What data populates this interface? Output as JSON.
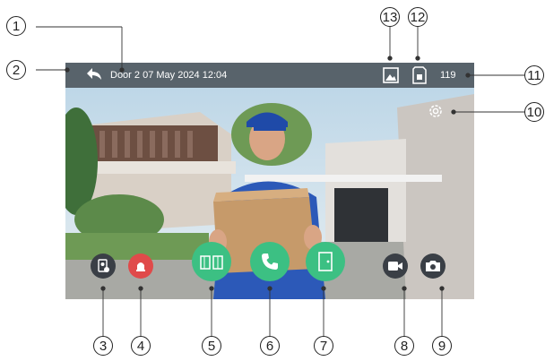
{
  "status_bar": {
    "title": "Door 2  07 May 2024 12:04",
    "count": "119"
  },
  "icons": {
    "back": "back-arrow-icon",
    "picture": "picture-icon",
    "sd_card": "sd-card-icon",
    "settings": "gear-icon",
    "monitor": "monitor-icon",
    "alarm": "alarm-bell-icon",
    "gate": "gate-icon",
    "call": "phone-icon",
    "door": "door-icon",
    "record": "video-record-icon",
    "snapshot": "camera-icon"
  },
  "callouts": [
    "1",
    "2",
    "3",
    "4",
    "5",
    "6",
    "7",
    "8",
    "9",
    "10",
    "11",
    "12",
    "13"
  ],
  "colors": {
    "green": "#3cc083",
    "red": "#e04a4a",
    "dark": "#3a3f46",
    "bar": "#3c4248"
  }
}
